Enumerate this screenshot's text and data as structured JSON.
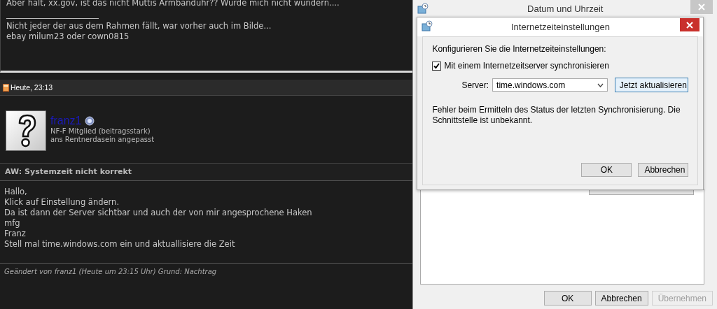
{
  "forum": {
    "previous_post": {
      "body_line": "Aber halt, xx.gov, ist das nicht Muttis Armbanduhr?? Würde mich nicht wundern....",
      "signature": [
        "Nicht jeder der aus dem Rahmen fällt, war vorher auch im Bilde...",
        "ebay milum23 oder cown0815"
      ]
    },
    "post": {
      "timestamp": "Heute, 23:13",
      "author": {
        "name": "franz1",
        "rank": [
          "NF-F Mitglied (beitragsstark)",
          "ans Rentnerdasein angepasst"
        ]
      },
      "title": "AW: Systemzeit nicht korrekt",
      "body": [
        "Hallo,",
        "Klick auf Einstellung ändern.",
        "Da ist dann der Server sichtbar und auch der von mir angesprochene Haken",
        "mfg",
        "Franz",
        "Stell mal time.windows.com ein und aktuallisiere die Zeit"
      ],
      "edit_note": "Geändert von franz1 (Heute um 23:15 Uhr) Grund: Nachtrag"
    }
  },
  "outer_window": {
    "title": "Datum und Uhrzeit",
    "buttons": [
      {
        "label": "OK",
        "disabled": false
      },
      {
        "label": "Abbrechen",
        "disabled": false
      },
      {
        "label": "Übernehmen",
        "disabled": true
      }
    ]
  },
  "dialog": {
    "title": "Internetzeiteinstellungen",
    "heading": "Konfigurieren Sie die Internetzeiteinstellungen:",
    "sync_checkbox": {
      "label": "Mit einem Internetzeitserver synchronisieren",
      "checked": true
    },
    "server": {
      "label": "Server:",
      "value": "time.windows.com"
    },
    "update_button": "Jetzt aktualisieren",
    "status_message": "Fehler beim Ermitteln des Status der letzten Synchronisierung. Die Schnittstelle ist unbekannt.",
    "buttons": [
      "OK",
      "Abbrechen"
    ]
  }
}
